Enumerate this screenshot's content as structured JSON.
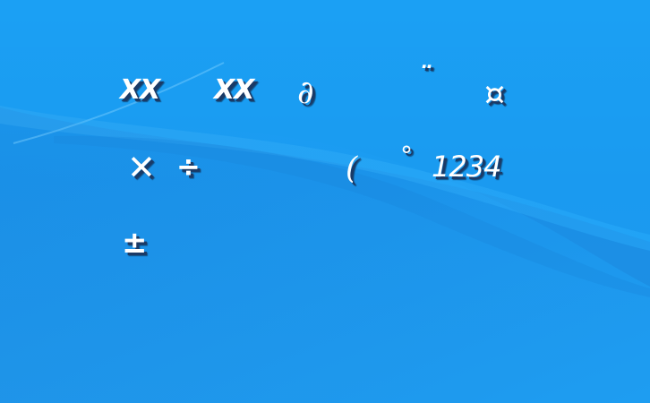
{
  "symbols": {
    "row1": {
      "xx_a": "XX",
      "xx_b": "XX",
      "partial": "∂",
      "diaeresis": "¨",
      "currency": "¤"
    },
    "row2": {
      "times": "✕",
      "divide": "÷",
      "paren": "(",
      "degree": "°",
      "number": "1234"
    },
    "row3": {
      "plusminus": "±"
    }
  },
  "colors": {
    "background_top": "#1b9cf0",
    "background_bottom": "#1f8fe3",
    "wave": "#2aa8f5",
    "text": "#ffffff",
    "shadow": "#1b3a66"
  }
}
